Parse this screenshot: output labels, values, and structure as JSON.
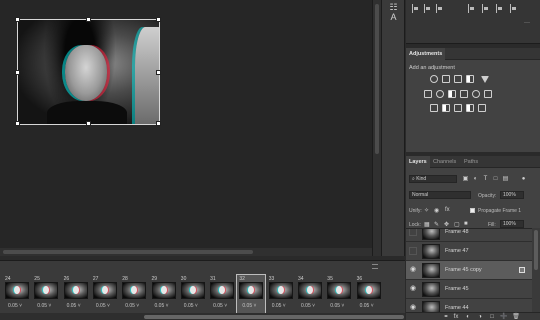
{
  "adjustments": {
    "tab": "Adjustments",
    "subtitle": "Add an adjustment"
  },
  "layers": {
    "tabs": [
      "Layers",
      "Channels",
      "Paths"
    ],
    "filter_kind": "Kind",
    "blend_mode": "Normal",
    "opacity_label": "Opacity:",
    "opacity_value": "100%",
    "unify_label": "Unify:",
    "propagate_label": "Propagate Frame 1",
    "lock_label": "Lock:",
    "fill_label": "Fill:",
    "fill_value": "100%",
    "items": [
      {
        "name": "Frame 48",
        "visible": false,
        "selected": false
      },
      {
        "name": "Frame 47",
        "visible": false,
        "selected": false
      },
      {
        "name": "Frame 45 copy",
        "visible": true,
        "selected": true
      },
      {
        "name": "Frame 45",
        "visible": true,
        "selected": false
      },
      {
        "name": "Frame 44",
        "visible": true,
        "selected": false
      }
    ]
  },
  "timeline": {
    "frames": [
      {
        "num": "24",
        "delay": "0.05"
      },
      {
        "num": "25",
        "delay": "0.05"
      },
      {
        "num": "26",
        "delay": "0.05"
      },
      {
        "num": "27",
        "delay": "0.05"
      },
      {
        "num": "28",
        "delay": "0.05"
      },
      {
        "num": "29",
        "delay": "0.05"
      },
      {
        "num": "30",
        "delay": "0.05"
      },
      {
        "num": "31",
        "delay": "0.05"
      },
      {
        "num": "32",
        "delay": "0.05",
        "selected": true
      },
      {
        "num": "33",
        "delay": "0.05"
      },
      {
        "num": "34",
        "delay": "0.05"
      },
      {
        "num": "35",
        "delay": "0.05"
      },
      {
        "num": "36",
        "delay": "0.05"
      }
    ],
    "delay_suffix": " ˅"
  },
  "icons": {
    "eye": "◉",
    "search": "⌕",
    "chevron": "˅",
    "check": "✓"
  },
  "colors": {
    "canvas_bg": "#262626",
    "panel_bg": "#424242",
    "selection": "#5c5c5c"
  }
}
